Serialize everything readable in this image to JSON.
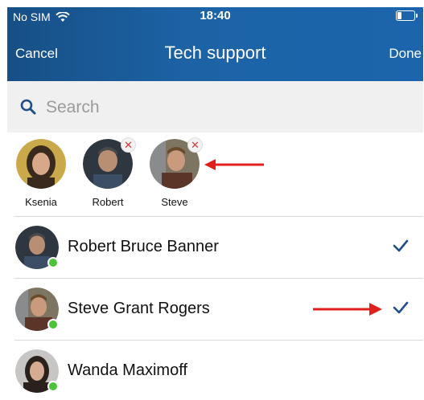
{
  "status_bar": {
    "carrier": "No SIM",
    "time": "18:40"
  },
  "nav": {
    "cancel_label": "Cancel",
    "title": "Tech support",
    "done_label": "Done"
  },
  "search": {
    "placeholder": "Search"
  },
  "selected": [
    {
      "name": "Ksenia",
      "removable": false
    },
    {
      "name": "Robert",
      "removable": true
    },
    {
      "name": "Steve",
      "removable": true
    }
  ],
  "contacts": [
    {
      "name": "Robert Bruce Banner",
      "online": true,
      "selected": true
    },
    {
      "name": "Steve Grant Rogers",
      "online": true,
      "selected": true
    },
    {
      "name": "Wanda Maximoff",
      "online": true,
      "selected": false
    }
  ],
  "colors": {
    "header": "#1c63a6",
    "accent": "#1f4f86",
    "online": "#4cc33a",
    "remove": "#d93838",
    "arrow": "#e0201c"
  },
  "icons": {
    "search": "search-icon",
    "remove": "close-icon",
    "check": "check-icon",
    "wifi": "wifi-icon",
    "battery": "battery-icon"
  }
}
